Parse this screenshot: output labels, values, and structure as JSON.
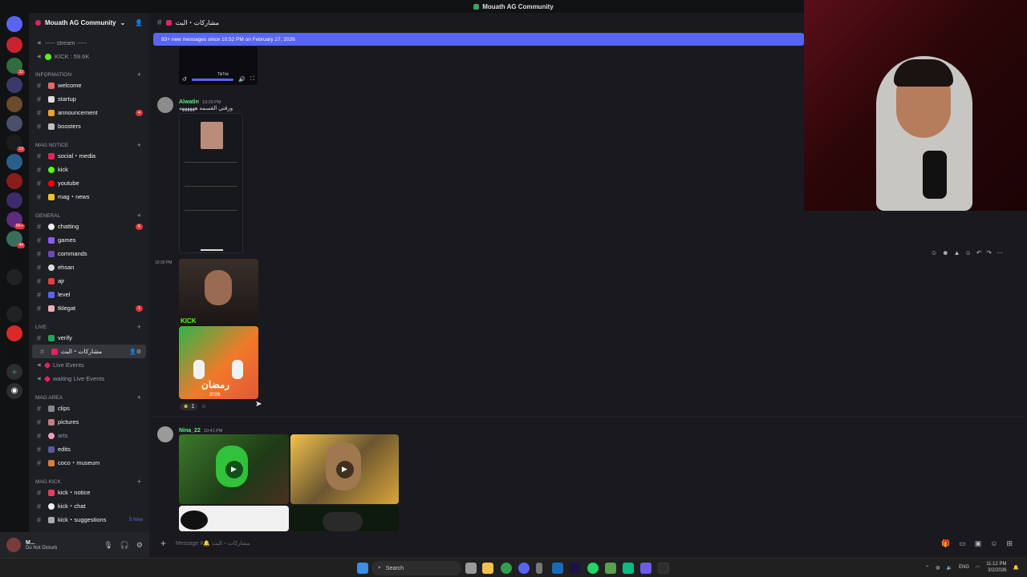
{
  "window": {
    "title": "Mouath AG Community"
  },
  "server": {
    "name": "Mouath AG Community",
    "chevron": "⌄"
  },
  "sidebar_top": [
    {
      "label": "----- stream -----"
    },
    {
      "label": "KICK : 59.6K"
    }
  ],
  "categories": [
    {
      "label": "INFORMATION"
    },
    {
      "label": "MAG NOTICE"
    },
    {
      "label": "GENERAL"
    },
    {
      "label": "LIVE"
    },
    {
      "label": "MAG AREA"
    },
    {
      "label": "MAG KICK"
    }
  ],
  "channels": [
    {
      "label": "welcome"
    },
    {
      "label": "startup"
    },
    {
      "label": "announcement",
      "badge": "4"
    },
    {
      "label": "boosters"
    },
    {
      "label": "social・media"
    },
    {
      "label": "kick"
    },
    {
      "label": "youtube"
    },
    {
      "label": "mag・news"
    },
    {
      "label": "chatting",
      "badge": "6"
    },
    {
      "label": "games"
    },
    {
      "label": "commands"
    },
    {
      "label": "ehsan"
    },
    {
      "label": "ajr"
    },
    {
      "label": "level"
    },
    {
      "label": "tklegat",
      "badge": "1"
    },
    {
      "label": "verify"
    },
    {
      "label": "مشاركات・البث"
    },
    {
      "label": "Live Events"
    },
    {
      "label": "waiting Live Events"
    },
    {
      "label": "clips"
    },
    {
      "label": "pictures"
    },
    {
      "label": "arts"
    },
    {
      "label": "edits"
    },
    {
      "label": "coco・museum"
    },
    {
      "label": "kick・notice"
    },
    {
      "label": "kick・chat"
    },
    {
      "label": "kick・suggestions",
      "new": "5 New"
    }
  ],
  "header": {
    "channel": "مشاركات・البث"
  },
  "banner": {
    "text": "93+ new messages since 10:52 PM on February 27, 2026"
  },
  "messages": [
    {
      "author": "Alwatin",
      "time": "10:29 PM",
      "text": "ورقتي القسمه ههههههه"
    },
    {
      "time": "10:30 PM",
      "reaction_count": "1"
    },
    {
      "author": "Nina_22",
      "time": "10:41 PM"
    }
  ],
  "video_controls": {
    "brand": "TikTok"
  },
  "media_captions": {
    "kick": "KICK",
    "ramadan": "رمضان",
    "year": "2026"
  },
  "composer": {
    "placeholder": "Message #🔔 مشاركات・البث"
  },
  "user": {
    "name": "M...",
    "status": "Do Not Disturb"
  },
  "taskbar": {
    "search": "Search",
    "lang": "ENG",
    "time": "11:12 PM",
    "date": "3/2/2026"
  },
  "colors": {
    "accent": "#5865f2",
    "badge": "#da373c",
    "online": "#57f287"
  }
}
